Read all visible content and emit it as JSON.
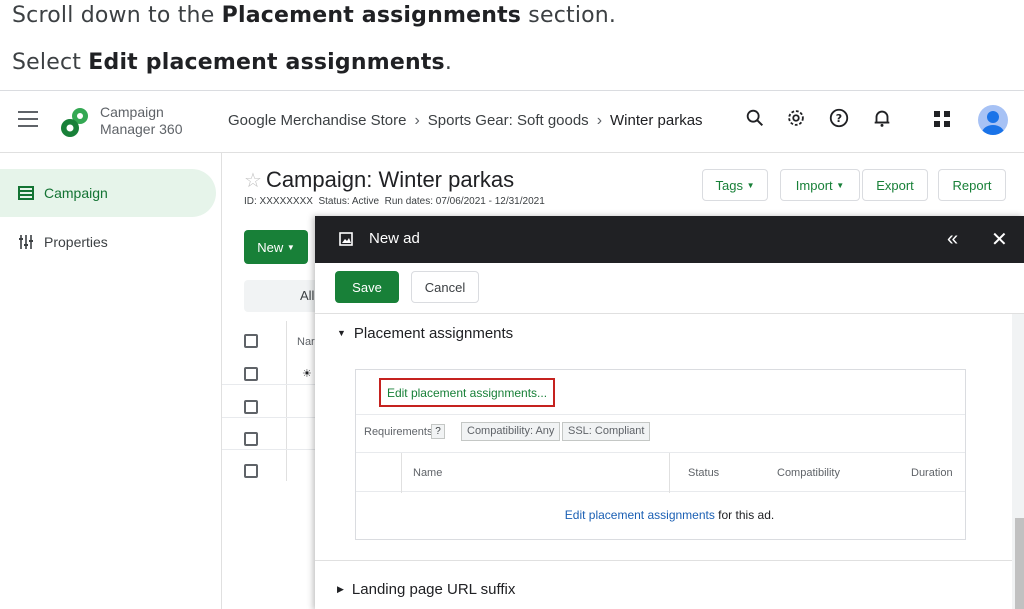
{
  "instructions": {
    "line1_pre": "Scroll down to the ",
    "line1_bold": "Placement assignments",
    "line1_post": " section.",
    "line2_pre": "Select ",
    "line2_bold": "Edit placement assignments",
    "line2_post": "."
  },
  "header": {
    "brand_line1": "Campaign",
    "brand_line2": "Manager 360",
    "breadcrumb": [
      "Google Merchandise Store",
      "Sports Gear: Soft goods",
      "Winter parkas"
    ],
    "icons": [
      "search-icon",
      "settings-icon",
      "help-icon",
      "notifications-icon",
      "apps-icon",
      "account-avatar"
    ]
  },
  "sidebar": {
    "items": [
      {
        "label": "Campaign",
        "icon": "table-icon",
        "active": true
      },
      {
        "label": "Properties",
        "icon": "tune-icon",
        "active": false
      }
    ]
  },
  "campaign": {
    "title": "Campaign: Winter parkas",
    "id_label": "ID: XXXXXXXX",
    "status_label": "Status: Active",
    "run_dates": "Run dates: 07/06/2021 - 12/31/2021",
    "buttons": {
      "tags": "Tags",
      "import": "Import",
      "export": "Export",
      "report": "Report"
    },
    "new_button": "New",
    "filter_tab": "All",
    "col_name_fragment": "Nar"
  },
  "dialog": {
    "title": "New ad",
    "save": "Save",
    "cancel": "Cancel",
    "placement_section": "Placement assignments",
    "edit_link": "Edit placement assignments...",
    "requirements_label": "Requirements",
    "help_mark": "?",
    "chip_compat": "Compatibility: Any",
    "chip_ssl": "SSL: Compliant",
    "columns": [
      "Name",
      "Status",
      "Compatibility",
      "Duration"
    ],
    "empty_link": "Edit placement assignments",
    "empty_suffix": " for this ad.",
    "landing_section": "Landing page URL suffix"
  },
  "colors": {
    "accent_green": "#188038",
    "highlight_red": "#c5221f",
    "link_blue": "#1a5fb4",
    "dialog_header": "#202124"
  }
}
